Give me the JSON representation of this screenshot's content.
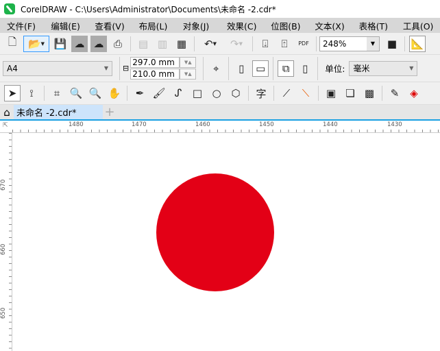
{
  "window": {
    "title": "CorelDRAW - C:\\Users\\Administrator\\Documents\\未命名 -2.cdr*"
  },
  "menu": [
    "文件(F)",
    "编辑(E)",
    "查看(V)",
    "布局(L)",
    "对象(J)",
    "效果(C)",
    "位图(B)",
    "文本(X)",
    "表格(T)",
    "工具(O)"
  ],
  "toolbar": {
    "zoom_value": "248%",
    "pdf_label": "PDF"
  },
  "property_bar": {
    "page_size": "A4",
    "width": "297.0 mm",
    "height": "210.0 mm",
    "units_label": "单位:",
    "units_value": "毫米"
  },
  "tabs": [
    {
      "label": "未命名 -2.cdr*"
    }
  ],
  "ruler": {
    "horizontal": [
      "1480",
      "1470",
      "1460",
      "1450",
      "1440",
      "1430"
    ],
    "vertical": [
      "670",
      "660",
      "650"
    ]
  },
  "shape": {
    "type": "circle",
    "fill": "#e30016"
  }
}
